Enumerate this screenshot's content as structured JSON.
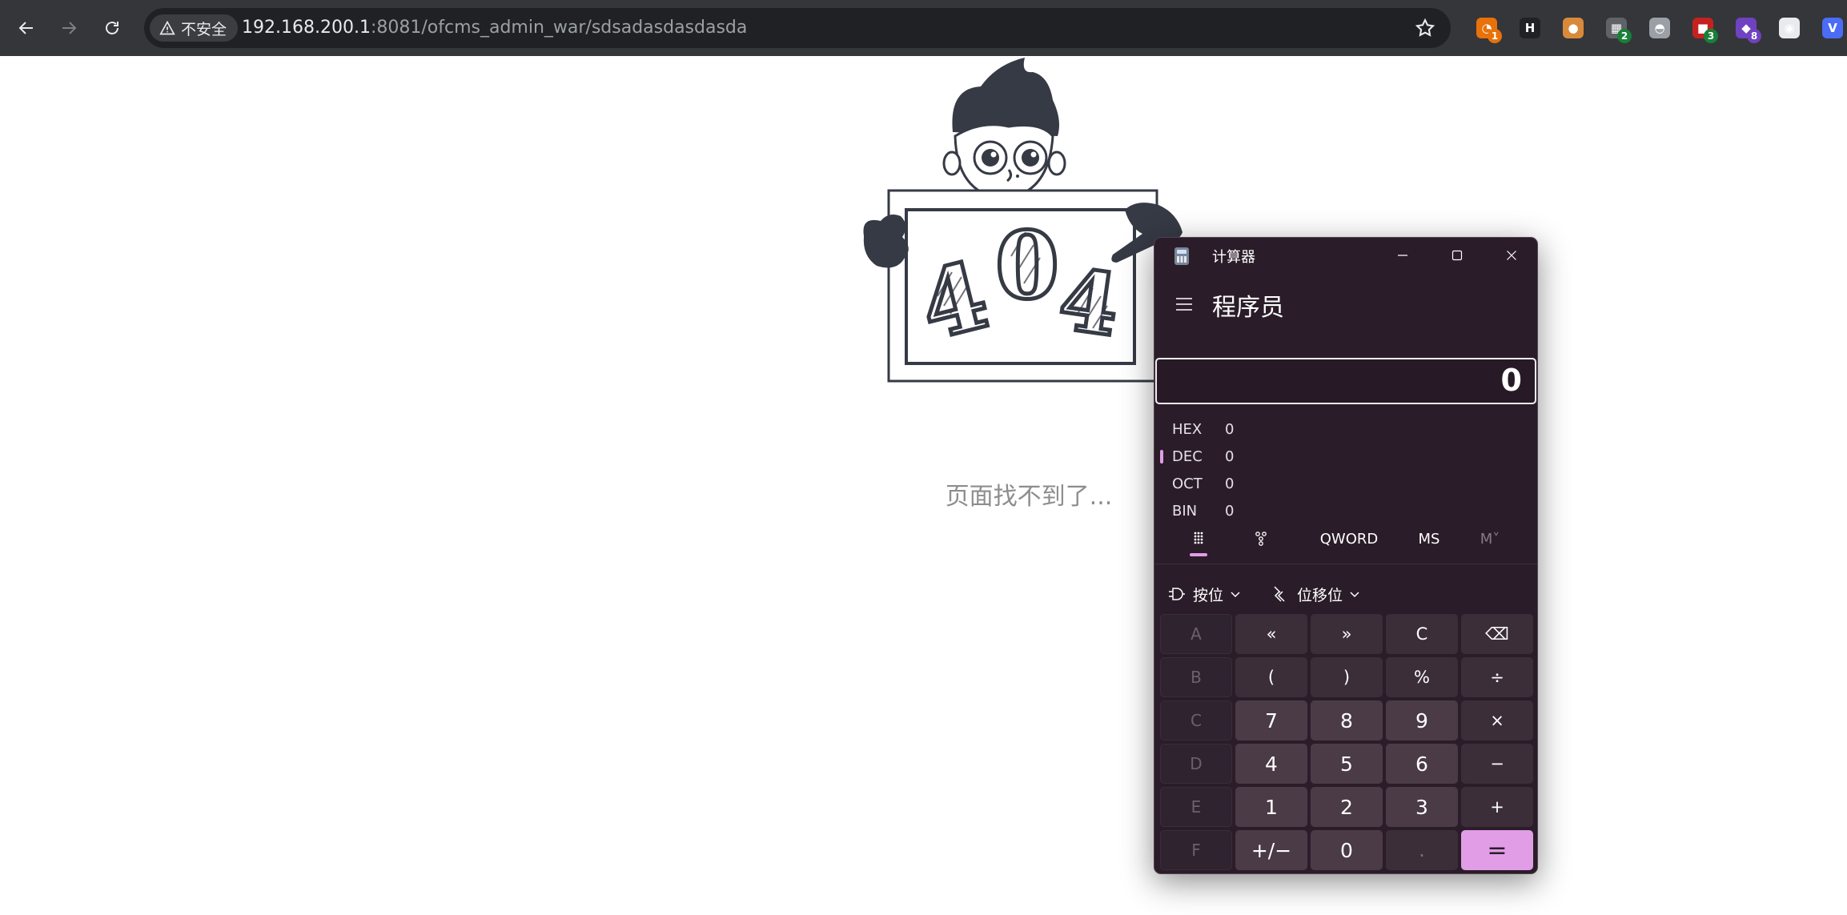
{
  "browser": {
    "security_label": "不安全",
    "url_host": "192.168.200.1",
    "url_rest": ":8081/ofcms_admin_war/sdsadasdasdasda",
    "extensions": [
      {
        "icon": "timer-extension-icon",
        "badge": "1",
        "color": "#e8710a"
      },
      {
        "icon": "h-extension-icon",
        "badge": "",
        "color": "#202124"
      },
      {
        "icon": "cookie-extension-icon",
        "badge": "",
        "color": "#d88a3a"
      },
      {
        "icon": "qr-extension-icon",
        "badge": "2",
        "color": "#5f6368"
      },
      {
        "icon": "hat-extension-icon",
        "badge": "",
        "color": "#9aa0a6"
      },
      {
        "icon": "red-box-extension-icon",
        "badge": "3",
        "color": "#c5221f"
      },
      {
        "icon": "purple-shape-extension-icon",
        "badge": "8",
        "color": "#6f42c1"
      },
      {
        "icon": "glasses-extension-icon",
        "badge": "",
        "color": "#e8eaed"
      },
      {
        "icon": "v-extension-icon",
        "badge": "",
        "color": "#4a6cf7"
      }
    ]
  },
  "page": {
    "illustration_text": "404",
    "message": "页面找不到了..."
  },
  "calculator": {
    "title": "计算器",
    "mode": "程序员",
    "display": "0",
    "radix": [
      {
        "name": "HEX",
        "value": "0",
        "active": false
      },
      {
        "name": "DEC",
        "value": "0",
        "active": true
      },
      {
        "name": "OCT",
        "value": "0",
        "active": false
      },
      {
        "name": "BIN",
        "value": "0",
        "active": false
      }
    ],
    "tabs": {
      "word_size": "QWORD",
      "ms": "MS",
      "mv": "M˅"
    },
    "ops": {
      "bitwise": "按位",
      "bitshift": "位移位"
    },
    "keys": [
      [
        "A",
        "«",
        "»",
        "C",
        "⌫"
      ],
      [
        "B",
        "(",
        ")",
        "%",
        "÷"
      ],
      [
        "C",
        "7",
        "8",
        "9",
        "×"
      ],
      [
        "D",
        "4",
        "5",
        "6",
        "−"
      ],
      [
        "E",
        "1",
        "2",
        "3",
        "+"
      ],
      [
        "F",
        "+/−",
        "0",
        ".",
        "="
      ]
    ],
    "accent_color": "#e29de7"
  }
}
